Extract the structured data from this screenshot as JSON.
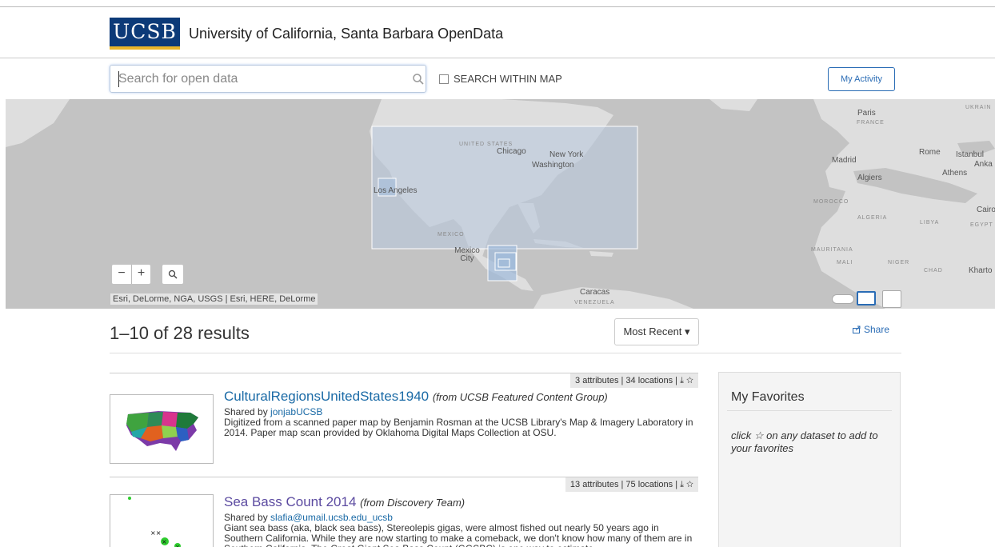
{
  "header": {
    "logo_text": "UCSB",
    "site_title": "University of California, Santa Barbara OpenData"
  },
  "search": {
    "placeholder": "Search for open data",
    "value": "",
    "within_map_label": "SEARCH WITHIN MAP",
    "within_map_checked": false,
    "my_activity_label": "My Activity"
  },
  "map": {
    "labels": [
      {
        "text": "UNITED STATES",
        "kind": "country"
      },
      {
        "text": "Chicago",
        "kind": "city"
      },
      {
        "text": "New York",
        "kind": "city"
      },
      {
        "text": "Washington",
        "kind": "city"
      },
      {
        "text": "Los Angeles",
        "kind": "city"
      },
      {
        "text": "MEXICO",
        "kind": "country"
      },
      {
        "text": "Mexico City",
        "kind": "city"
      },
      {
        "text": "Caracas",
        "kind": "city"
      },
      {
        "text": "VENEZUELA",
        "kind": "country"
      },
      {
        "text": "Paris",
        "kind": "city"
      },
      {
        "text": "FRANCE",
        "kind": "country"
      },
      {
        "text": "Madrid",
        "kind": "city"
      },
      {
        "text": "Rome",
        "kind": "city"
      },
      {
        "text": "Istanbul",
        "kind": "city"
      },
      {
        "text": "Anka",
        "kind": "city"
      },
      {
        "text": "Athens",
        "kind": "city"
      },
      {
        "text": "Algiers",
        "kind": "city"
      },
      {
        "text": "MOROCCO",
        "kind": "country"
      },
      {
        "text": "ALGERIA",
        "kind": "country"
      },
      {
        "text": "LIBYA",
        "kind": "country"
      },
      {
        "text": "Cairo",
        "kind": "city"
      },
      {
        "text": "EGYPT",
        "kind": "country"
      },
      {
        "text": "MAURITANIA",
        "kind": "country"
      },
      {
        "text": "MALI",
        "kind": "country"
      },
      {
        "text": "NIGER",
        "kind": "country"
      },
      {
        "text": "CHAD",
        "kind": "country"
      },
      {
        "text": "Kharto",
        "kind": "city"
      },
      {
        "text": "UKRAIN",
        "kind": "country"
      }
    ],
    "zoom_out_label": "−",
    "zoom_in_label": "+",
    "attribution": "Esri, DeLorme, NGA, USGS | Esri, HERE, DeLorme"
  },
  "results": {
    "summary": "1–10 of 28 results",
    "sort_label": "Most Recent ▾",
    "share_label": "Share"
  },
  "items": [
    {
      "meta": "3 attributes | 34 locations | ⤓ ☆",
      "title": "CulturalRegionsUnitedStates1940",
      "source": "(from UCSB Featured Content Group)",
      "shared_prefix": "Shared by ",
      "shared_by": "jonjabUCSB",
      "description": "Digitized from a scanned paper map by Benjamin Rosman at the UCSB Library's Map & Imagery Laboratory in 2014. Paper map scan provided by Oklahoma Digital Maps Collection at OSU."
    },
    {
      "meta": "13 attributes | 75 locations | ⤓ ☆",
      "title": "Sea Bass Count 2014",
      "source": "(from Discovery Team)",
      "shared_prefix": "Shared by ",
      "shared_by": "slafia@umail.ucsb.edu_ucsb",
      "description": "Giant sea bass (aka, black sea bass), Stereolepis gigas, were almost fished out nearly 50 years ago in Southern California. While they are now starting to make a comeback, we don't know how many of them are in Southern California. The Great Giant Sea Bass Count (GGSBC) is one way to estimate"
    }
  ],
  "favorites": {
    "title": "My Favorites",
    "hint": "click ☆ on any dataset to add to your favorites"
  },
  "colors": {
    "brand_blue": "#0c3a78",
    "brand_gold": "#e9b52a",
    "link": "#1a6aa6",
    "map_water": "#c3c3c3",
    "map_land": "#dedede"
  }
}
